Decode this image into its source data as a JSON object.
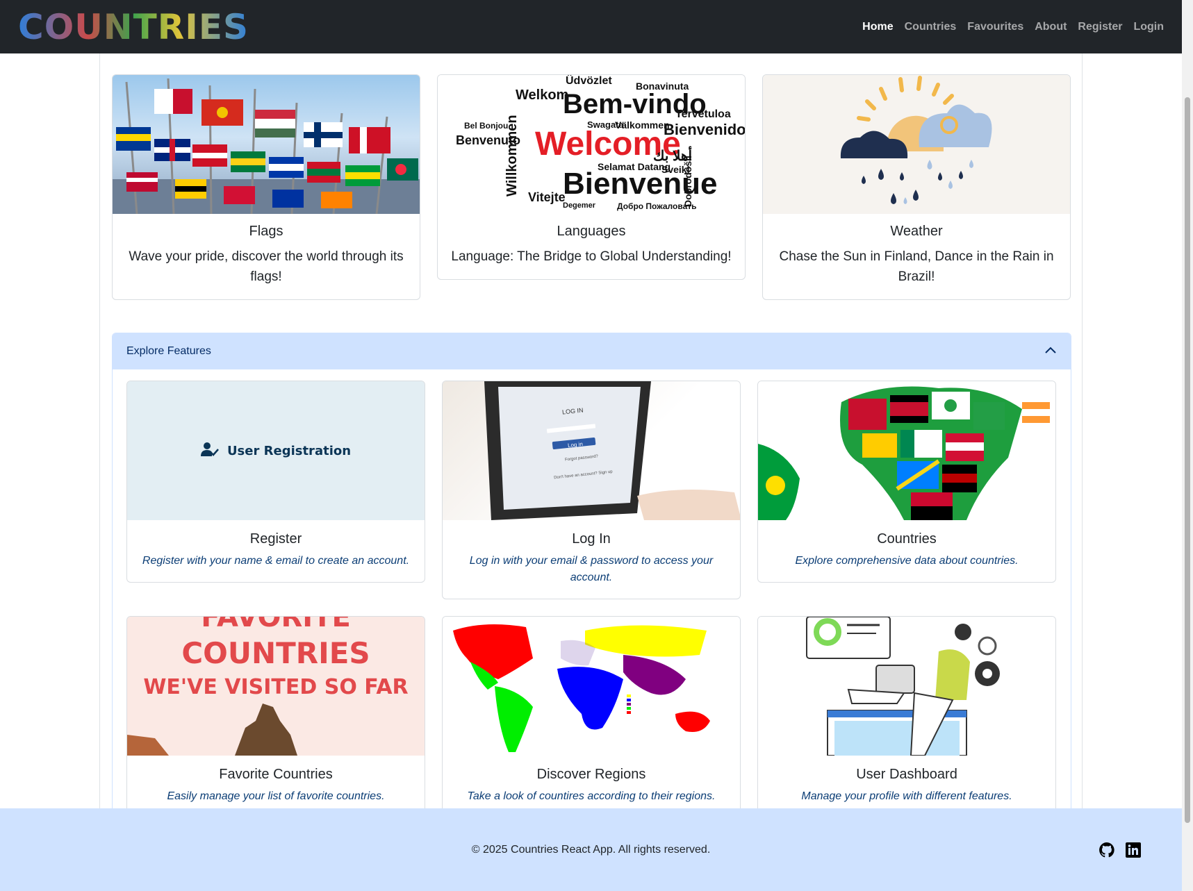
{
  "brand": "COUNTRIES",
  "nav": {
    "home": "Home",
    "countries": "Countries",
    "favourites": "Favourites",
    "about": "About",
    "register": "Register",
    "login": "Login"
  },
  "top_cards": [
    {
      "title": "Flags",
      "text": "Wave your pride, discover the world through its flags!"
    },
    {
      "title": "Languages",
      "text": "Language: The Bridge to Global Understanding!"
    },
    {
      "title": "Weather",
      "text": "Chase the Sun in Finland, Dance in the Rain in Brazil!"
    }
  ],
  "language_words": {
    "big1": "Welcome",
    "big2": "Bienvenue",
    "big3": "Bem-vindo",
    "w1": "Willkommen",
    "w2": "Bienvenido",
    "w3": "Benvenuto",
    "w4": "Welkom",
    "w5": "Tervetuloa",
    "w6": "Vitejte",
    "w7": "Swagata",
    "w8": "Välkommen",
    "w9": "Selamat Datang",
    "w10": "Dobrodošli",
    "w11": "Sveiki",
    "w12": "Üdvözlet",
    "w13": "Bonavinuta",
    "w14": "Bel Bonjou",
    "w15": "Добро Пожаловать",
    "w16": "أهلا بك",
    "w17": "Degemer"
  },
  "accordion": {
    "header": "Explore Features"
  },
  "registration_label": "User Registration",
  "features": [
    {
      "title": "Register",
      "text": "Register with your name & email to create an account."
    },
    {
      "title": "Log In",
      "text": "Log in with your email & password to access your account."
    },
    {
      "title": "Countries",
      "text": "Explore comprehensive data about countries."
    },
    {
      "title": "Favorite Countries",
      "text": "Easily manage your list of favorite countries."
    },
    {
      "title": "Discover Regions",
      "text": "Take a look of countires according to their regions."
    },
    {
      "title": "User Dashboard",
      "text": "Manage your profile with different features."
    }
  ],
  "login_image": {
    "title": "LOG IN",
    "button": "Log in",
    "forgot": "Forgot password?",
    "signup": "Don't have an account? Sign up"
  },
  "fav_image": {
    "line1": "FAVORITE",
    "line2": "COUNTRIES",
    "line3": "WE'VE VISITED SO FAR"
  },
  "footer": {
    "text": "© 2025 Countries React App. All rights reserved."
  },
  "icons": {
    "github": "github-icon",
    "linkedin": "linkedin-icon",
    "chevron": "chevron-up-icon",
    "user_check": "user-check-icon"
  },
  "colors": {
    "navbar": "#212529",
    "accordion_header": "#cfe2ff",
    "footer": "#cfe2ff",
    "feature_text": "#0b3d75"
  }
}
